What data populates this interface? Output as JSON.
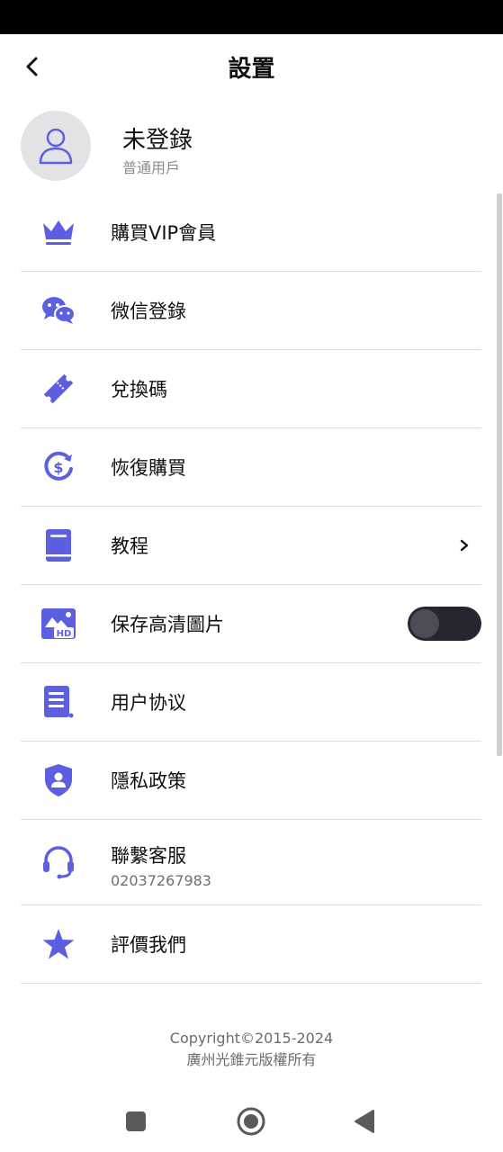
{
  "header": {
    "title": "設置"
  },
  "profile": {
    "name": "未登錄",
    "subtitle": "普通用戶"
  },
  "accent_color": "#5b5fe0",
  "menu": {
    "vip": {
      "label": "購買VIP會員",
      "icon": "crown-icon"
    },
    "wechat": {
      "label": "微信登錄",
      "icon": "wechat-icon"
    },
    "redeem": {
      "label": "兌換碼",
      "icon": "ticket-icon"
    },
    "restore": {
      "label": "恢復購買",
      "icon": "dollar-refresh-icon"
    },
    "tutorial": {
      "label": "教程",
      "icon": "book-icon"
    },
    "hd": {
      "label": "保存高清圖片",
      "icon": "hd-image-icon",
      "toggle_on": false
    },
    "agreement": {
      "label": "用户协议",
      "icon": "document-icon"
    },
    "privacy": {
      "label": "隱私政策",
      "icon": "shield-user-icon"
    },
    "support": {
      "label": "聯繫客服",
      "phone": "02037267983",
      "icon": "headset-icon"
    },
    "rate": {
      "label": "評價我們",
      "icon": "star-icon"
    }
  },
  "footer": {
    "copyright": "Copyright©2015-2024",
    "company": "廣州光錐元版權所有"
  }
}
